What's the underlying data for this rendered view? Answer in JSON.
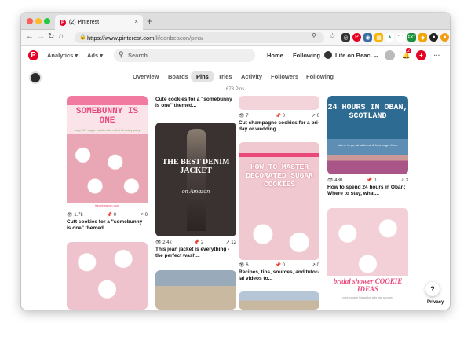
{
  "browser": {
    "tab_title": "(2) Pinterest",
    "tab_close": "×",
    "new_tab": "+",
    "url_host": "https://www.pinterest.com",
    "url_path": "/lifeonbeacon/pins/"
  },
  "header": {
    "analytics": "Analytics ▾",
    "ads": "Ads ▾",
    "search_placeholder": "Search",
    "home": "Home",
    "following": "Following",
    "profile_name": "Life on Beac...",
    "notifications_count": "2"
  },
  "profile_tabs": [
    {
      "label": "Overview"
    },
    {
      "label": "Boards"
    },
    {
      "label": "Pins"
    },
    {
      "label": "Tries"
    },
    {
      "label": "Activity"
    },
    {
      "label": "Followers"
    },
    {
      "label": "Following"
    }
  ],
  "pin_count": "673 Pins",
  "pins": {
    "p1": {
      "headline": "SOMEBUNNY IS ONE",
      "sub": "easy DIY sugar cookies for a first birthday party",
      "site": "lifeonbeacon.com",
      "saves": "1.7k",
      "repins": "0",
      "shares": "0",
      "title": "Cutt cookies for a \"somebunny is one\" themed..."
    },
    "p2": {
      "title": "Cute cookies for a \"somebunny is one\" themed..."
    },
    "p3": {
      "headline": "THE BEST DENIM JACKET",
      "sub": "on Amazon",
      "saves": "2.4k",
      "repins": "2",
      "shares": "12",
      "title": "This jean jacket is everything - the perfect wash..."
    },
    "p4": {
      "saves": "7",
      "repins": "0",
      "shares": "0",
      "title": "Cut champagne cookies for a bri-day or wedding..."
    },
    "p5": {
      "headline": "HOW TO MASTER DECORATED SUGAR COOKIES",
      "saves": "6",
      "repins": "0",
      "shares": "0",
      "title": "Recipes, tips, sources, and tutor-ial videos to..."
    },
    "p6": {
      "headline": "24 HOURS IN OBAN, SCOTLAND",
      "sub": "where to go, what to eat & how to get there",
      "saves": "430",
      "repins": "0",
      "shares": "3",
      "title": "How to spend 24 hours in Oban: Where to stay, what..."
    },
    "p7": {
      "headline": "bridal shower COOKIE IDEAS",
      "sub": "cute cookie ideas for a bridal shower"
    }
  },
  "help": "?",
  "privacy": "Privacy"
}
